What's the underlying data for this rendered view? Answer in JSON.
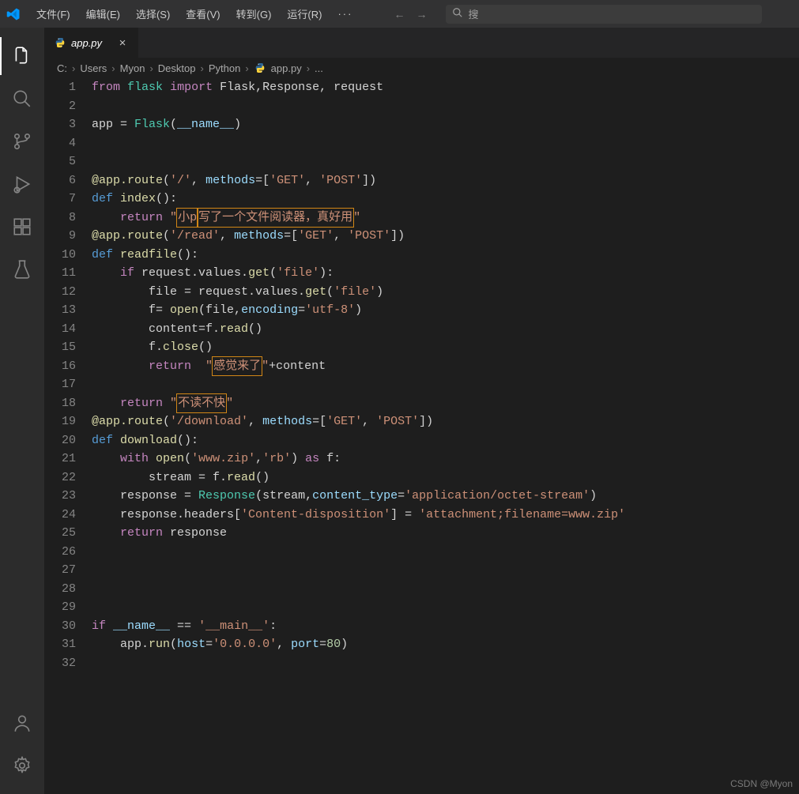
{
  "menu": {
    "file": "文件(F)",
    "edit": "编辑(E)",
    "select": "选择(S)",
    "view": "查看(V)",
    "go": "转到(G)",
    "run": "运行(R)",
    "more": "···"
  },
  "search": {
    "placeholder": "搜"
  },
  "tab": {
    "file_name": "app.py",
    "close": "×"
  },
  "breadcrumbs": {
    "parts": [
      "C:",
      "Users",
      "Myon",
      "Desktop",
      "Python"
    ],
    "file": "app.py",
    "ellipsis": "..."
  },
  "code": {
    "lines": [
      [
        {
          "t": "from",
          "c": "kw"
        },
        {
          "t": " "
        },
        {
          "t": "flask",
          "c": "cls"
        },
        {
          "t": " "
        },
        {
          "t": "import",
          "c": "kw"
        },
        {
          "t": " Flask,Response, request"
        }
      ],
      [],
      [
        {
          "t": "app = "
        },
        {
          "t": "Flask",
          "c": "cls"
        },
        {
          "t": "("
        },
        {
          "t": "__name__",
          "c": "id"
        },
        {
          "t": ")"
        }
      ],
      [],
      [],
      [
        {
          "t": "@app.route",
          "c": "fn"
        },
        {
          "t": "("
        },
        {
          "t": "'/'",
          "c": "str"
        },
        {
          "t": ", "
        },
        {
          "t": "methods",
          "c": "id"
        },
        {
          "t": "=["
        },
        {
          "t": "'GET'",
          "c": "str"
        },
        {
          "t": ", "
        },
        {
          "t": "'POST'",
          "c": "str"
        },
        {
          "t": "])"
        }
      ],
      [
        {
          "t": "def",
          "c": "const"
        },
        {
          "t": " "
        },
        {
          "t": "index",
          "c": "fn"
        },
        {
          "t": "():"
        }
      ],
      [
        {
          "t": "    ",
          "ig": 1
        },
        {
          "t": "return",
          "c": "kw"
        },
        {
          "t": " "
        },
        {
          "t": "\"",
          "c": "str"
        },
        {
          "t": "小p",
          "c": "str",
          "hl": true
        },
        {
          "t": "写了一个文件阅读器，真好用",
          "c": "str",
          "hl": true
        },
        {
          "t": "\"",
          "c": "str"
        }
      ],
      [
        {
          "t": "@app.route",
          "c": "fn"
        },
        {
          "t": "("
        },
        {
          "t": "'/read'",
          "c": "str"
        },
        {
          "t": ", "
        },
        {
          "t": "methods",
          "c": "id"
        },
        {
          "t": "=["
        },
        {
          "t": "'GET'",
          "c": "str"
        },
        {
          "t": ", "
        },
        {
          "t": "'POST'",
          "c": "str"
        },
        {
          "t": "])"
        }
      ],
      [
        {
          "t": "def",
          "c": "const"
        },
        {
          "t": " "
        },
        {
          "t": "readfile",
          "c": "fn"
        },
        {
          "t": "():"
        }
      ],
      [
        {
          "t": "    ",
          "ig": 1
        },
        {
          "t": "if",
          "c": "kw"
        },
        {
          "t": " request.values."
        },
        {
          "t": "get",
          "c": "fn"
        },
        {
          "t": "("
        },
        {
          "t": "'file'",
          "c": "str"
        },
        {
          "t": "):"
        }
      ],
      [
        {
          "t": "        ",
          "ig": 2
        },
        {
          "t": "file = request.values."
        },
        {
          "t": "get",
          "c": "fn"
        },
        {
          "t": "("
        },
        {
          "t": "'file'",
          "c": "str"
        },
        {
          "t": ")"
        }
      ],
      [
        {
          "t": "        ",
          "ig": 2
        },
        {
          "t": "f= "
        },
        {
          "t": "open",
          "c": "fn"
        },
        {
          "t": "(file,"
        },
        {
          "t": "encoding",
          "c": "id"
        },
        {
          "t": "="
        },
        {
          "t": "'utf-8'",
          "c": "str"
        },
        {
          "t": ")"
        }
      ],
      [
        {
          "t": "        ",
          "ig": 2
        },
        {
          "t": "content=f."
        },
        {
          "t": "read",
          "c": "fn"
        },
        {
          "t": "()"
        }
      ],
      [
        {
          "t": "        ",
          "ig": 2
        },
        {
          "t": "f."
        },
        {
          "t": "close",
          "c": "fn"
        },
        {
          "t": "()"
        }
      ],
      [
        {
          "t": "        ",
          "ig": 2
        },
        {
          "t": "return",
          "c": "kw"
        },
        {
          "t": "  "
        },
        {
          "t": "\"",
          "c": "str"
        },
        {
          "t": "感觉来了",
          "c": "str",
          "hl": true
        },
        {
          "t": "\"",
          "c": "str"
        },
        {
          "t": "+content"
        }
      ],
      [],
      [
        {
          "t": "    ",
          "ig": 1
        },
        {
          "t": "return",
          "c": "kw"
        },
        {
          "t": " "
        },
        {
          "t": "\"",
          "c": "str"
        },
        {
          "t": "不读不快",
          "c": "str",
          "hl": true
        },
        {
          "t": "\"",
          "c": "str"
        }
      ],
      [
        {
          "t": "@app.route",
          "c": "fn"
        },
        {
          "t": "("
        },
        {
          "t": "'/download'",
          "c": "str"
        },
        {
          "t": ", "
        },
        {
          "t": "methods",
          "c": "id"
        },
        {
          "t": "=["
        },
        {
          "t": "'GET'",
          "c": "str"
        },
        {
          "t": ", "
        },
        {
          "t": "'POST'",
          "c": "str"
        },
        {
          "t": "])"
        }
      ],
      [
        {
          "t": "def",
          "c": "const"
        },
        {
          "t": " "
        },
        {
          "t": "download",
          "c": "fn"
        },
        {
          "t": "():"
        }
      ],
      [
        {
          "t": "    ",
          "ig": 1
        },
        {
          "t": "with",
          "c": "kw"
        },
        {
          "t": " "
        },
        {
          "t": "open",
          "c": "fn"
        },
        {
          "t": "("
        },
        {
          "t": "'www.zip'",
          "c": "str"
        },
        {
          "t": ","
        },
        {
          "t": "'rb'",
          "c": "str"
        },
        {
          "t": ") "
        },
        {
          "t": "as",
          "c": "kw"
        },
        {
          "t": " f:"
        }
      ],
      [
        {
          "t": "        ",
          "ig": 2
        },
        {
          "t": "stream = f."
        },
        {
          "t": "read",
          "c": "fn"
        },
        {
          "t": "()"
        }
      ],
      [
        {
          "t": "    ",
          "ig": 1
        },
        {
          "t": "response = "
        },
        {
          "t": "Response",
          "c": "cls"
        },
        {
          "t": "(stream,"
        },
        {
          "t": "content_type",
          "c": "id"
        },
        {
          "t": "="
        },
        {
          "t": "'application/octet-stream'",
          "c": "str"
        },
        {
          "t": ")"
        }
      ],
      [
        {
          "t": "    ",
          "ig": 1
        },
        {
          "t": "response.headers["
        },
        {
          "t": "'Content-disposition'",
          "c": "str"
        },
        {
          "t": "] = "
        },
        {
          "t": "'attachment;filename=www.zip'",
          "c": "str"
        }
      ],
      [
        {
          "t": "    ",
          "ig": 1
        },
        {
          "t": "return",
          "c": "kw"
        },
        {
          "t": " response"
        }
      ],
      [],
      [],
      [],
      [],
      [
        {
          "t": "if",
          "c": "kw"
        },
        {
          "t": " "
        },
        {
          "t": "__name__",
          "c": "id"
        },
        {
          "t": " == "
        },
        {
          "t": "'__main__'",
          "c": "str"
        },
        {
          "t": ":"
        }
      ],
      [
        {
          "t": "    ",
          "ig": 1
        },
        {
          "t": "app."
        },
        {
          "t": "run",
          "c": "fn"
        },
        {
          "t": "("
        },
        {
          "t": "host",
          "c": "id"
        },
        {
          "t": "="
        },
        {
          "t": "'0.0.0.0'",
          "c": "str"
        },
        {
          "t": ", "
        },
        {
          "t": "port",
          "c": "id"
        },
        {
          "t": "="
        },
        {
          "t": "80",
          "c": "num"
        },
        {
          "t": ")"
        }
      ],
      []
    ]
  },
  "watermark": "CSDN @Myon"
}
